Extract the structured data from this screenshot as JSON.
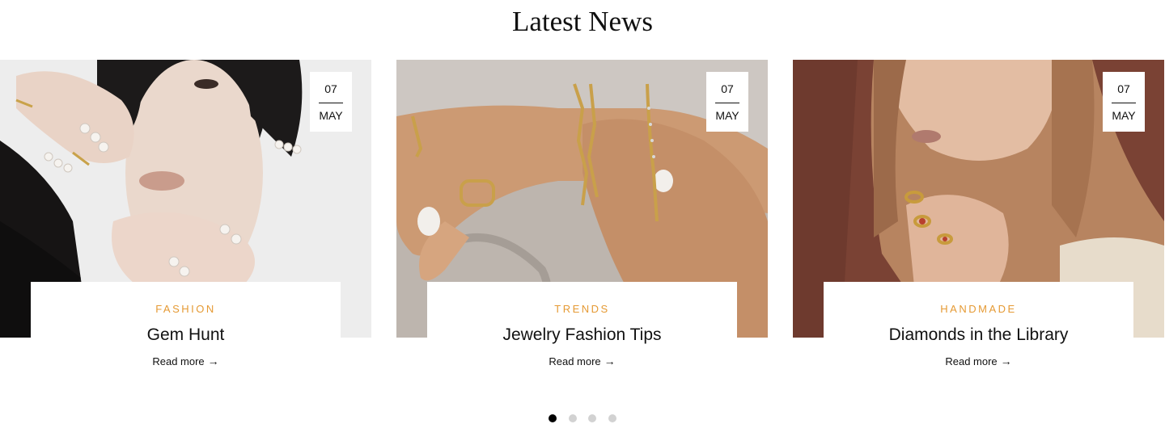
{
  "section": {
    "title": "Latest News"
  },
  "cards": [
    {
      "day": "07",
      "month": "MAY",
      "category": "FASHION",
      "title": "Gem Hunt",
      "read_more": "Read more",
      "arrow_icon": "arrow-right-icon",
      "image": "woman-pearl-rings-photo"
    },
    {
      "day": "07",
      "month": "MAY",
      "category": "TRENDS",
      "title": "Jewelry Fashion Tips",
      "read_more": "Read more",
      "arrow_icon": "arrow-right-icon",
      "image": "gold-chain-bracelets-photo"
    },
    {
      "day": "07",
      "month": "MAY",
      "category": "HANDMADE",
      "title": "Diamonds in the Library",
      "read_more": "Read more",
      "arrow_icon": "arrow-right-icon",
      "image": "woman-gold-rings-photo"
    }
  ],
  "pagination": {
    "count": 4,
    "active": 1
  },
  "colors": {
    "accent": "#e59a34",
    "dot_active": "#000000",
    "dot_inactive": "#d2d2d2"
  }
}
